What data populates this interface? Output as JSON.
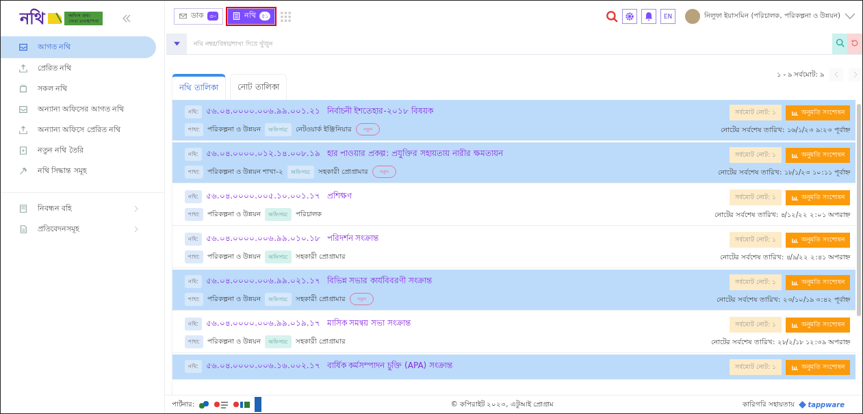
{
  "logo": {
    "wordmark": "নথি",
    "tagline": [
      "অফিস তথ্য",
      "সেবা ব্যবস্থাপনা"
    ]
  },
  "sidebar": {
    "items": [
      {
        "label": "আগত নথি",
        "selected": true
      },
      {
        "label": "প্রেরিত নথি",
        "selected": false
      },
      {
        "label": "সকল নথি",
        "selected": false
      },
      {
        "label": "অন্যান্য অফিসের আগত নথি",
        "selected": false
      },
      {
        "label": "অন্যান্য অফিসে প্রেরিত নথি",
        "selected": false
      },
      {
        "label": "নতুন নথি তৈরি",
        "selected": false
      },
      {
        "label": "নথি সিদ্ধান্ত সমূহ",
        "selected": false
      }
    ],
    "sections": [
      {
        "label": "নিবন্ধন বহি"
      },
      {
        "label": "প্রতিবেদনসমূহ"
      }
    ]
  },
  "header": {
    "modules": [
      {
        "label": "ডাক",
        "count": "৩০",
        "selected": false
      },
      {
        "label": "নথি",
        "count": "৫১",
        "selected": true
      }
    ],
    "language": "EN",
    "user": "নিলুফা ইয়াসমিন (পরিচালক, পরিকল্পনা ও উন্নয়ন)"
  },
  "search": {
    "placeholder": "নথি নম্বর/বিষয়/শাখা দিয়ে খুঁজুন"
  },
  "tabs": [
    {
      "label": "নথি তালিকা",
      "selected": true
    },
    {
      "label": "নোট তালিকা",
      "selected": false
    }
  ],
  "pagination": "১ - ৯ সর্বমোট: ৯",
  "rows": [
    {
      "unread": true,
      "nothi_label": "নথি:",
      "number": "৫৬.০৪.০০০০.০০৬.৯৯.০০১.২১",
      "subject": "নির্বাচনী ইশতেহার-২০১৮ বিষয়ক",
      "branch_label": "শাখা:",
      "branch": "পরিকল্পনা ও উন্নয়ন",
      "officer_label": "অফিসার:",
      "officer": "নেটওয়ার্ক ইঞ্জিনিয়ার",
      "badge": "নতুন",
      "note_count": "সর্বমোট নোট: ১",
      "action": "অনুমতি সংশোধন",
      "last_date": "নোটের সর্বশেষ তারিখ: ১৬/১/২৩ ৯:২৩ পূর্বাহ্ন"
    },
    {
      "unread": true,
      "nothi_label": "নথি:",
      "number": "৫৬.০৪.০০০০.০১২.১৪.০০৮.১৯",
      "subject": "হার পাওয়ার প্রকল্প: প্রযুক্তির সহায়তায় নারীর ক্ষমতায়ন",
      "branch_label": "শাখা:",
      "branch": "পরিকল্পনা ও উন্নয়ন শাখা-২",
      "officer_label": "অফিসার:",
      "officer": "সহকারী প্রোগ্রামার",
      "badge": "নতুন",
      "note_count": "সর্বমোট নোট: ১",
      "action": "অনুমতি সংশোধন",
      "last_date": "নোটের সর্বশেষ তারিখ: ১৮/১/২৩ ১০:১১ পূর্বাহ্ন"
    },
    {
      "unread": false,
      "nothi_label": "নথি:",
      "number": "৫৬.০৪.০০০০.০০৫.১০.০০১.১৭",
      "subject": "প্রশিক্ষণ",
      "branch_label": "শাখা:",
      "branch": "পরিকল্পনা ও উন্নয়ন",
      "officer_label": "অফিসার:",
      "officer": "পরিচালক",
      "note_count": "সর্বমোট নোট: ১",
      "action": "অনুমতি সংশোধন",
      "last_date": "নোটের সর্বশেষ তারিখ: ৪/১২/২২ ২:০১ অপরাহ্ন"
    },
    {
      "unread": false,
      "nothi_label": "নথি:",
      "number": "৫৬.০৪.০০০০.০০৬.৯৯.০১০.১৮",
      "subject": "পরিদর্শন সংক্রান্ত",
      "branch_label": "শাখা:",
      "branch": "পরিকল্পনা ও উন্নয়ন",
      "officer_label": "অফিসার:",
      "officer": "সহকারী প্রোগ্রামার",
      "note_count": "সর্বমোট নোট: ১",
      "action": "অনুমতি সংশোধন",
      "last_date": "নোটের সর্বশেষ তারিখ: ৪/৯/২২ ২:৪১ অপরাহ্ন"
    },
    {
      "unread": true,
      "nothi_label": "নথি:",
      "number": "৫৬.০৪.০০০০.০০৬.৯৯.০২১.১৭",
      "subject": "বিভিন্ন সভার কার্যবিবরণী সংক্রান্ত",
      "branch_label": "শাখা:",
      "branch": "পরিকল্পনা ও উন্নয়ন",
      "officer_label": "অফিসার:",
      "officer": "সহকারী প্রোগ্রামার",
      "badge": "নতুন",
      "note_count": "সর্বমোট নোট: ১",
      "action": "অনুমতি সংশোধন",
      "last_date": "নোটের সর্বশেষ তারিখ: ২৩/১০/১৯ ৩:৪২ পূর্বাহ্ন"
    },
    {
      "unread": false,
      "nothi_label": "নথি:",
      "number": "৫৬.০৪.০০০০.০০৬.৯৯.০১৯.১৭",
      "subject": "মাসিক সমন্বয় সভা সংক্রান্ত",
      "branch_label": "শাখা:",
      "branch": "পরিকল্পনা ও উন্নয়ন",
      "officer_label": "অফিসার:",
      "officer": "সহকারী প্রোগ্রামার",
      "note_count": "সর্বমোট নোট: ১",
      "action": "অনুমতি সংশোধন",
      "last_date": "নোটের সর্বশেষ তারিখ: ২৮/২/১৮ ১২:৩৯ অপরাহ্ন"
    },
    {
      "unread": true,
      "nothi_label": "নথি:",
      "number": "৫৬.০৪.০০০০.০০৬.১৬.০০২.১৭",
      "subject": "বার্ষিক কর্মসম্পাদন চুক্তি (APA) সংক্রান্ত",
      "note_count": "সর্বমোট নোট: ১",
      "action": "অনুমতি সংশোধন"
    }
  ],
  "footer": {
    "partners_label": "পার্টনার:",
    "copyright": "© কপিরাইট ২০২৩, এটুআই প্রোগ্রাম",
    "support_label": "কারিগরি সহায়তায়",
    "support_brand": "tappware"
  }
}
